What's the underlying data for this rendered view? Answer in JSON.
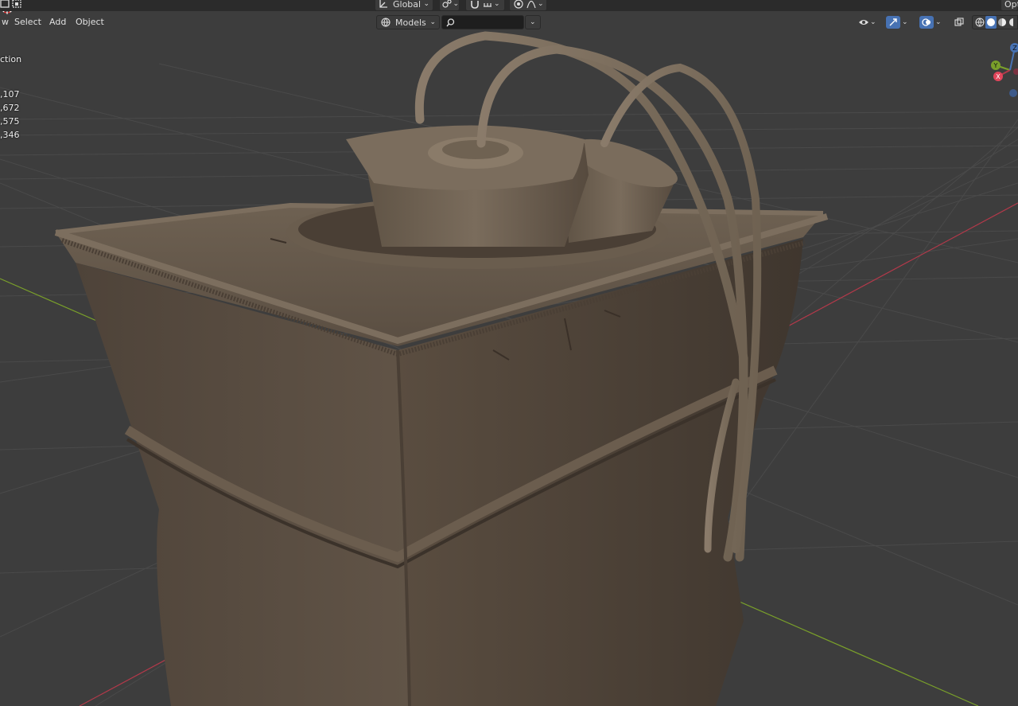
{
  "header": {
    "menus": {
      "view_label": "w",
      "select_label": "Select",
      "add_label": "Add",
      "object_label": "Object"
    },
    "transform_orientation": "Global",
    "collection_filter": "Models",
    "search": {
      "placeholder": "",
      "value": ""
    },
    "options_label": "Opt"
  },
  "stats": {
    "title": "ction",
    "rows": [
      ",107",
      ",672",
      ",575",
      ",346"
    ]
  },
  "icons": {
    "select_box": "select-box-icon",
    "orientation": "axis-orientation-icon",
    "pivot": "pivot-icon",
    "snap": "magnet-snap-icon",
    "proportional": "proportional-edit-icon",
    "falloff": "falloff-curve-icon",
    "collection": "globe-collection-icon",
    "search": "search-icon",
    "visibility": "eye-visibility-icon",
    "gizmo": "gizmo-icon",
    "overlay": "overlay-icon",
    "xray": "xray-icon",
    "shading": [
      "wireframe-shading-icon",
      "solid-shading-icon",
      "material-shading-icon",
      "rendered-shading-icon"
    ]
  },
  "navigation_gizmo": {
    "axes": [
      "Y",
      "X",
      "Z"
    ]
  },
  "colors": {
    "viewport_bg": "#3d3d3d",
    "grid": "#4a4a4a",
    "axis_x": "#b3394a",
    "axis_y": "#7aa02a",
    "model": "#5e5145",
    "accent_blue": "#4772b3"
  }
}
